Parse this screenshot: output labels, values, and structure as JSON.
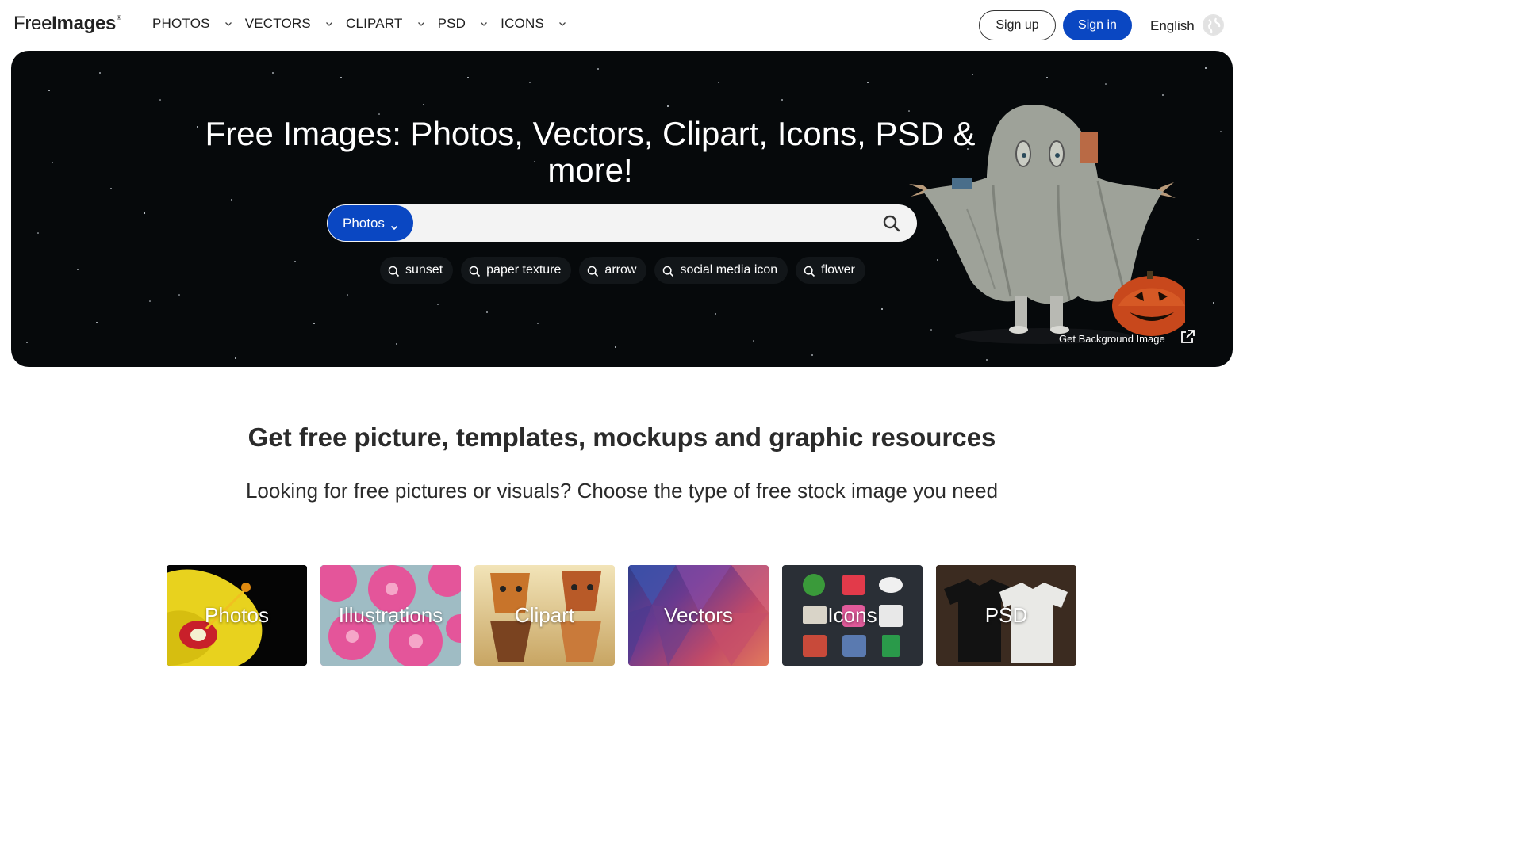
{
  "header": {
    "logo_free": "Free",
    "logo_images": "Images",
    "logo_reg": "®",
    "nav": [
      {
        "label": "PHOTOS"
      },
      {
        "label": "VECTORS"
      },
      {
        "label": "CLIPART"
      },
      {
        "label": "PSD"
      },
      {
        "label": "ICONS"
      }
    ],
    "signup_label": "Sign up",
    "signin_label": "Sign in",
    "language": "English"
  },
  "hero": {
    "title_line1": "Free Images: Photos, Vectors, Clipart, Icons, PSD &",
    "title_line2": "more!",
    "search": {
      "type_label": "Photos",
      "value": "",
      "placeholder": ""
    },
    "chips": [
      {
        "label": "sunset"
      },
      {
        "label": "paper texture"
      },
      {
        "label": "arrow"
      },
      {
        "label": "social media icon"
      },
      {
        "label": "flower"
      }
    ],
    "get_background_label": "Get Background Image"
  },
  "section": {
    "title": "Get free picture, templates, mockups and graphic resources",
    "subtitle": "Looking for free pictures or visuals? Choose the type of free stock image you need"
  },
  "categories": [
    {
      "label": "Photos"
    },
    {
      "label": "Illustrations"
    },
    {
      "label": "Clipart"
    },
    {
      "label": "Vectors"
    },
    {
      "label": "Icons"
    },
    {
      "label": "PSD"
    }
  ],
  "colors": {
    "brand_blue": "#0a47c2",
    "hero_bg": "#06090b"
  }
}
